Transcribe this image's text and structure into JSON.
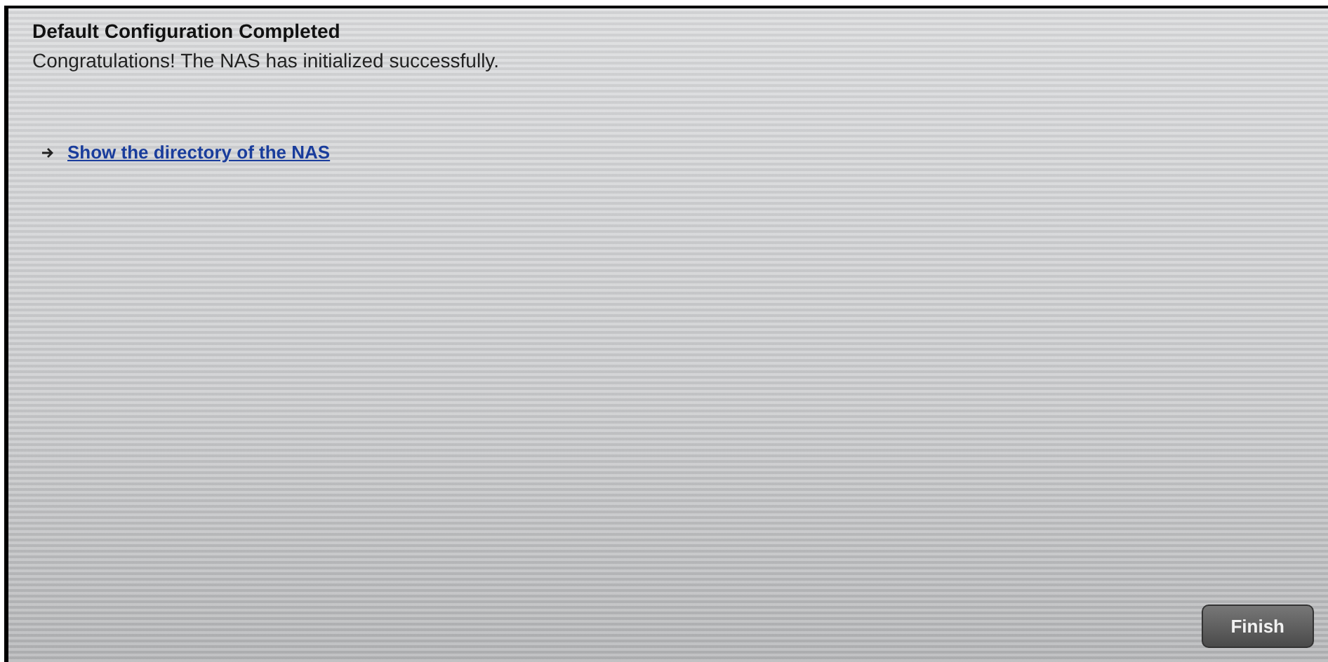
{
  "heading": "Default Configuration Completed",
  "message": "Congratulations! The NAS has initialized successfully.",
  "link": {
    "label": "Show the directory of the NAS"
  },
  "buttons": [
    "Finish"
  ]
}
